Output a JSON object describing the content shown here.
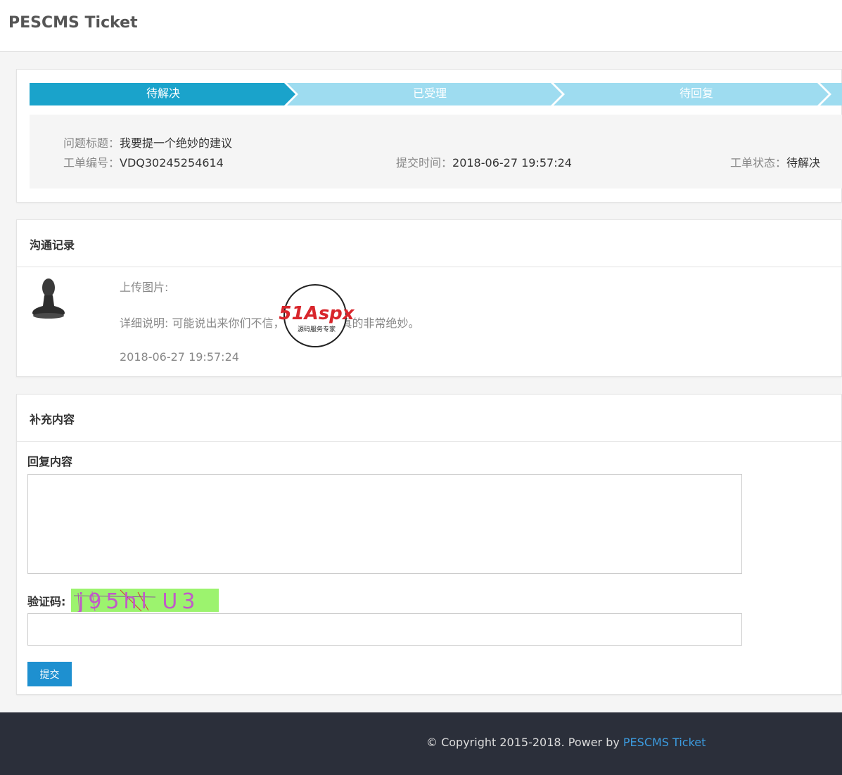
{
  "app": {
    "brand": "PESCMS Ticket"
  },
  "steps": [
    {
      "label": "待解决"
    },
    {
      "label": "已受理"
    },
    {
      "label": "待回复"
    }
  ],
  "ticket": {
    "title_label": "问题标题：",
    "title_value": "我要提一个绝妙的建议",
    "number_label": "工单编号：",
    "number_value": "VDQ30245254614",
    "time_label": "提交时间：",
    "time_value": "2018-06-27 19:57:24",
    "status_label": "工单状态：",
    "status_value": "待解决"
  },
  "log": {
    "title": "沟通记录",
    "upload_label": "上传图片:",
    "detail": "详细说明: 可能说出来你们不信，但我的建议真的非常绝妙。",
    "time": "2018-06-27 19:57:24",
    "watermark_main": "51Aspx",
    "watermark_sub": "源码服务专家"
  },
  "reply": {
    "title": "补充内容",
    "content_label": "回复内容",
    "captcha_label": "验证码:",
    "captcha_text": "j95hl U3",
    "submit_label": "提交"
  },
  "footer": {
    "copyright": "© Copyright 2015-2018. Power by ",
    "link": "PESCMS Ticket"
  },
  "colors": {
    "step_active": "#1aa3cb",
    "step_inactive": "#9edcf0",
    "footer_bg": "#2b2f3a",
    "link": "#3c9ce0",
    "captcha_bg": "#9cf36e"
  }
}
